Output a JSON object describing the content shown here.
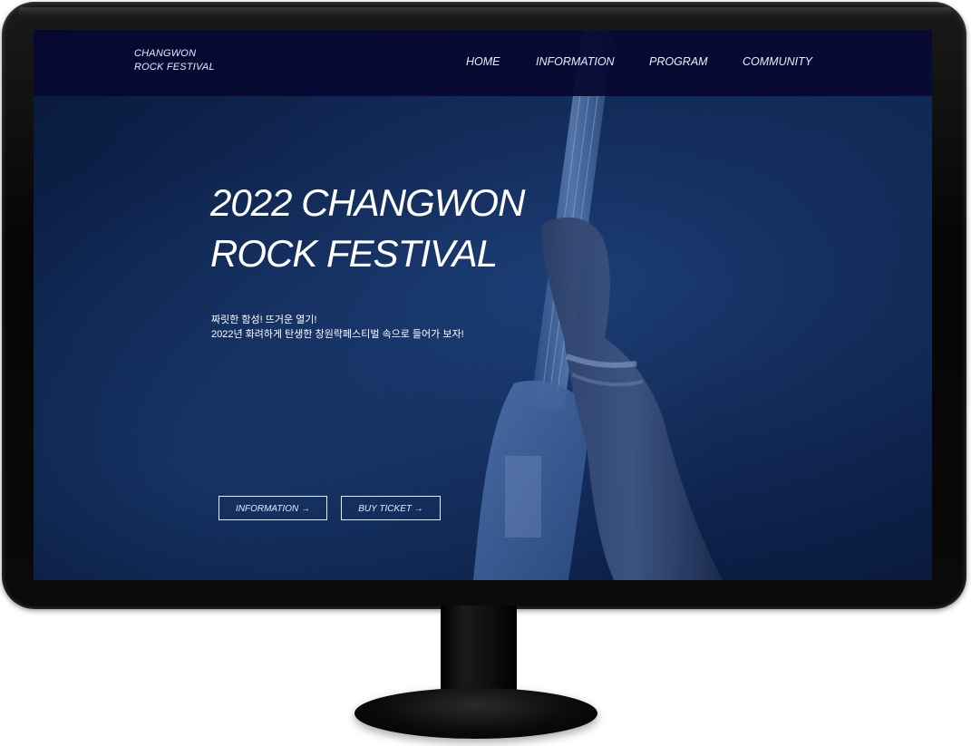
{
  "nav": {
    "logo_line1": "CHANGWON",
    "logo_line2": "ROCK FESTIVAL",
    "items": [
      {
        "label": "HOME"
      },
      {
        "label": "INFORMATION"
      },
      {
        "label": "PROGRAM"
      },
      {
        "label": "COMMUNITY"
      }
    ]
  },
  "hero": {
    "title_line1": "2022 CHANGWON",
    "title_line2": "ROCK FESTIVAL",
    "subtitle_line1": "짜릿한 함성! 뜨거운 열기!",
    "subtitle_line2": "2022년 화려하게 탄생한 창원락페스티벌 속으로 들어가 보자!",
    "buttons": [
      {
        "label": "INFORMATION →"
      },
      {
        "label": "BUY TICKET →"
      }
    ]
  },
  "colors": {
    "nav_bg": "#060830",
    "hero_bg": "#132c5a",
    "text": "#ffffff",
    "bezel": "#050505"
  }
}
